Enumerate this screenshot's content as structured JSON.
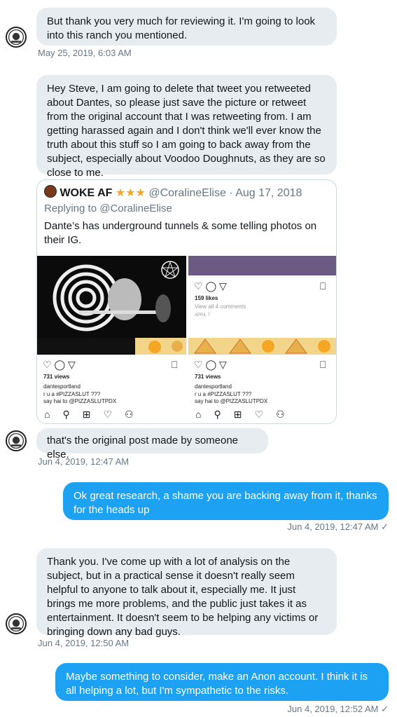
{
  "messages": {
    "m1": {
      "text": "But thank you very much for reviewing it. I'm going to look into this ranch you mentioned.",
      "timestamp": "May 25, 2019, 6:03 AM"
    },
    "m2": {
      "text": "Hey Steve, I am going to delete that tweet you retweeted about Dantes, so please just save the picture or retweet from the original account that I was retweeting from. I am getting harassed again and I don't think we'll ever know the truth about this stuff so I am going to back away from the subject, especially about Voodoo Doughnuts, as they are so close to me."
    },
    "m3": {
      "text": "that's the original post made by someone else.",
      "timestamp": "Jun 4, 2019, 12:47 AM"
    },
    "m4": {
      "text": "Ok great research, a shame you are backing away from it, thanks for the heads up",
      "timestamp": "Jun 4, 2019, 12:47 AM ✓"
    },
    "m5": {
      "text": "Thank you. I've come up with a lot of analysis on the subject, but in a practical sense it doesn't really seem helpful to anyone to talk about it, especially me. It just brings me more problems, and the public just takes it as entertainment. It doesn't seem to be helping any victims or bringing down any bad guys.",
      "timestamp": "Jun 4, 2019, 12:50 AM"
    },
    "m6": {
      "text": "Maybe something to consider, make an Anon account. I think it is all helping a lot, but I'm sympathetic to the risks.",
      "timestamp": "Jun 4, 2019, 12:52 AM ✓"
    }
  },
  "quote": {
    "name": "WOKE AF",
    "stars": "★★★",
    "handle": "@CoralineElise · Aug 17, 2018",
    "replying_prefix": "Replying to ",
    "replying_to": "@CoralineElise",
    "text": "Dante’s has underground tunnels & some telling photos on their IG.",
    "ig_right_top": {
      "likes": "159 likes",
      "comments": "View all 4 comments",
      "date": "APRIL 7"
    },
    "ig_left": {
      "views": "731 views",
      "user": "dantesportland",
      "line1": "r u a #PIZZASLUT ???",
      "line2": "say hai to @PIZZASLUTPDX"
    },
    "ig_right": {
      "views": "731 views",
      "user": "dantesportland",
      "line1": "r u a #PIZZASLUT ???",
      "line2": "say hai to @PIZZASLUTPDX"
    }
  },
  "colors": {
    "outgoing_bubble": "#1da1f2",
    "incoming_bubble": "#e6ecf0",
    "timestamp": "#657786",
    "star": "#f5a623"
  }
}
